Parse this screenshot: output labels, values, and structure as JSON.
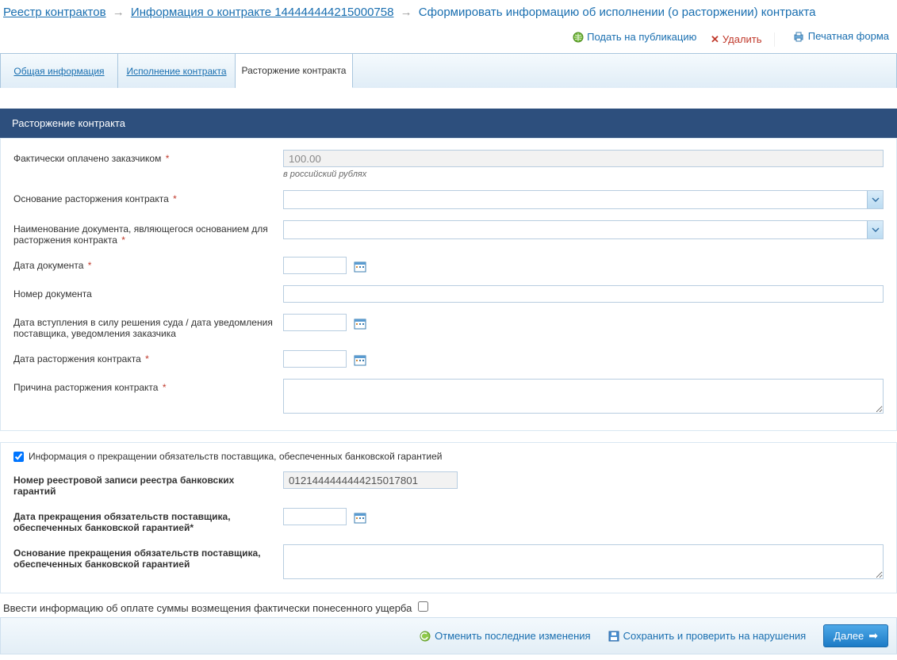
{
  "breadcrumb": {
    "link1": "Реестр контрактов",
    "link2": "Информация о контракте 144444444215000758",
    "current": "Сформировать информацию об исполнении (о расторжении) контракта"
  },
  "actions": {
    "publish": "Подать на публикацию",
    "delete": "Удалить",
    "print": "Печатная форма"
  },
  "tabs": {
    "t1": "Общая информация",
    "t2": "Исполнение контракта",
    "t3": "Расторжение контракта"
  },
  "panel": {
    "title": "Расторжение контракта",
    "fields": {
      "paid_label": "Фактически оплачено заказчиком",
      "paid_value": "100.00",
      "paid_hint": "в российский рублях",
      "basis_label": "Основание расторжения контракта",
      "docname_label": "Наименование документа, являющегося основанием для расторжения контракта",
      "docdate_label": "Дата документа",
      "docnum_label": "Номер документа",
      "courtdate_label": "Дата вступления в силу решения суда / дата уведомления поставщика, уведомления заказчика",
      "termdate_label": "Дата расторжения контракта",
      "reason_label": "Причина расторжения контракта"
    }
  },
  "panel2": {
    "checkbox_label": "Информация о прекращении обязательств поставщика, обеспеченных банковской гарантией",
    "regnum_label": "Номер реестровой записи реестра банковских гарантий",
    "regnum_value": "0121444444444215017801",
    "stopdate_label": "Дата прекращения обязательств поставщика, обеспеченных банковской гарантией*",
    "stopbasis_label": "Основание прекращения обязательств поставщика, обеспеченных банковской гарантией"
  },
  "damage": {
    "label": "Ввести информацию об оплате суммы возмещения фактически понесенного ущерба"
  },
  "bottom": {
    "cancel": "Отменить последние изменения",
    "save": "Сохранить и проверить на нарушения",
    "next": "Далее"
  }
}
